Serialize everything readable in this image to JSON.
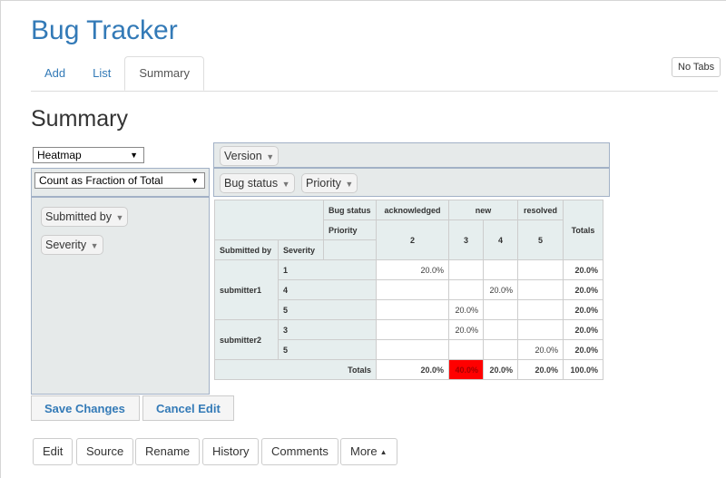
{
  "app": {
    "title": "Bug Tracker",
    "no_tabs_label": "No Tabs"
  },
  "tabs": [
    {
      "label": "Add",
      "active": false
    },
    {
      "label": "List",
      "active": false
    },
    {
      "label": "Summary",
      "active": true
    }
  ],
  "page": {
    "heading": "Summary"
  },
  "pivot": {
    "renderer": "Heatmap",
    "aggregator": "Count as Fraction of Total",
    "col_attrs": [
      "Version"
    ],
    "row_attr_area": [
      "Bug status",
      "Priority"
    ],
    "unused_attrs": [
      "Submitted by",
      "Severity"
    ],
    "table": {
      "header_labels": {
        "bug_status": "Bug status",
        "priority": "Priority",
        "submitted_by": "Submitted by",
        "severity": "Severity",
        "totals": "Totals"
      },
      "bug_status_values": [
        "acknowledged",
        "new",
        "resolved"
      ],
      "priority_values": [
        "2",
        "3",
        "4",
        "5"
      ],
      "row_groups": [
        "submitter1",
        "submitter2"
      ],
      "rows": [
        {
          "severity": "1",
          "cells": [
            "20.0%",
            "",
            "",
            ""
          ],
          "total": "20.0%"
        },
        {
          "severity": "4",
          "cells": [
            "",
            "",
            "20.0%",
            ""
          ],
          "total": "20.0%"
        },
        {
          "severity": "5",
          "cells": [
            "",
            "20.0%",
            "",
            ""
          ],
          "total": "20.0%"
        },
        {
          "severity": "3",
          "cells": [
            "",
            "20.0%",
            "",
            ""
          ],
          "total": "20.0%"
        },
        {
          "severity": "5",
          "cells": [
            "",
            "",
            "",
            "20.0%"
          ],
          "total": "20.0%"
        }
      ],
      "totals_label": "Totals",
      "col_totals": [
        "20.0%",
        "40.0%",
        "20.0%",
        "20.0%"
      ],
      "grand_total": "100.0%",
      "heat_color": "#ff0000"
    }
  },
  "edit_buttons": {
    "save": "Save Changes",
    "cancel": "Cancel Edit"
  },
  "footer_buttons": [
    "Edit",
    "Source",
    "Rename",
    "History",
    "Comments",
    "More"
  ]
}
